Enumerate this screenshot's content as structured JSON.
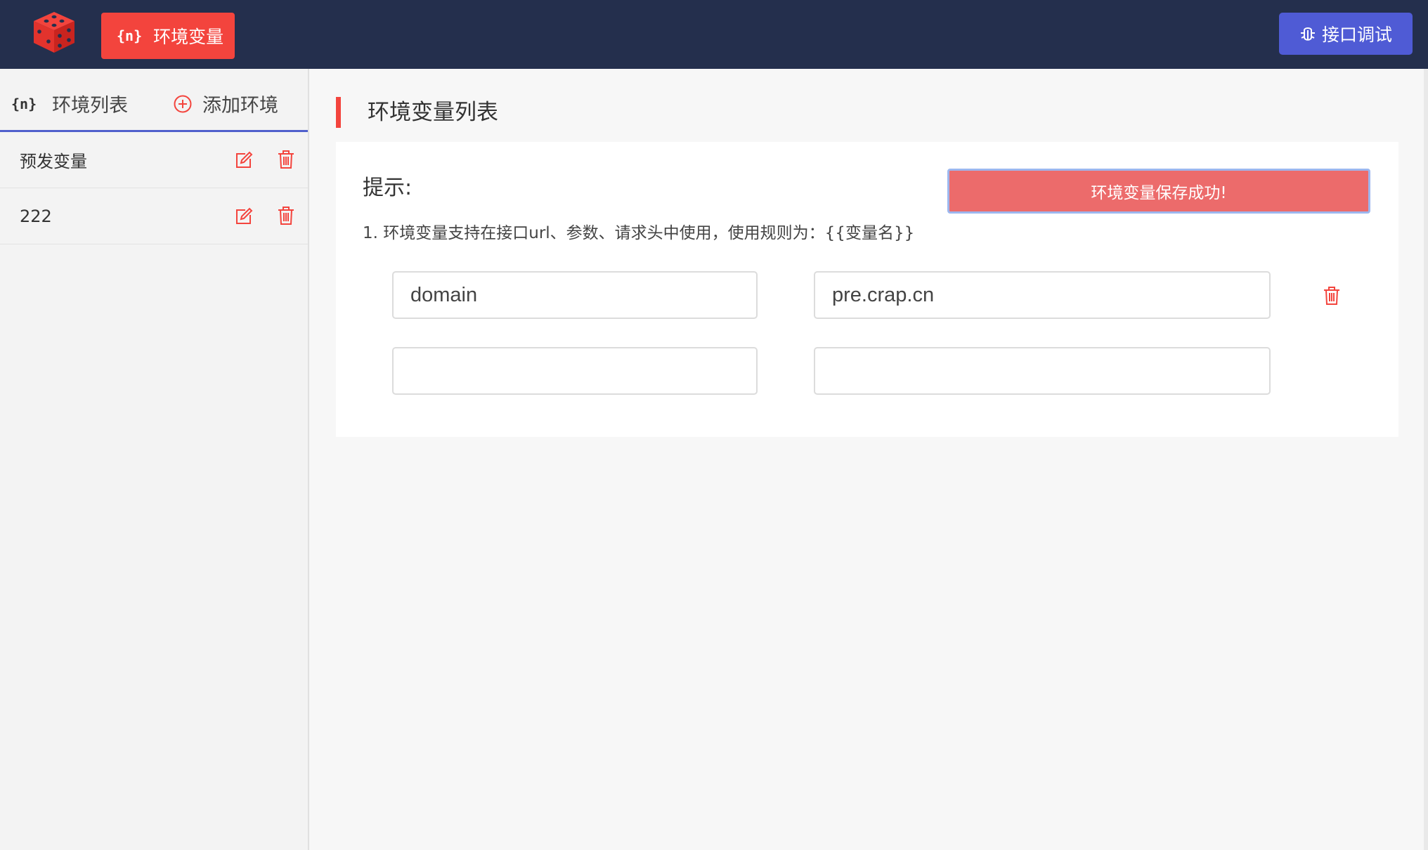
{
  "header": {
    "env_tab_code": "{n}",
    "env_tab_label": "环境变量",
    "debug_button_label": "接口调试"
  },
  "sidebar": {
    "list_tab_code": "{n}",
    "list_tab_label": "环境列表",
    "add_tab_label": "添加环境",
    "items": [
      {
        "label": "预发变量"
      },
      {
        "label": "222"
      }
    ]
  },
  "main": {
    "section_title": "环境变量列表",
    "hint_title": "提示:",
    "hint_text": "1. 环境变量支持在接口url、参数、请求头中使用，使用规则为：{{变量名}}",
    "toast": "环境变量保存成功!",
    "rows": [
      {
        "name": "domain",
        "value": "pre.crap.cn"
      },
      {
        "name": "",
        "value": ""
      }
    ]
  },
  "colors": {
    "header_bg": "#242f4d",
    "accent_red": "#f3443d",
    "accent_blue": "#4f5bd5",
    "toast_bg": "#ec6b6b"
  }
}
